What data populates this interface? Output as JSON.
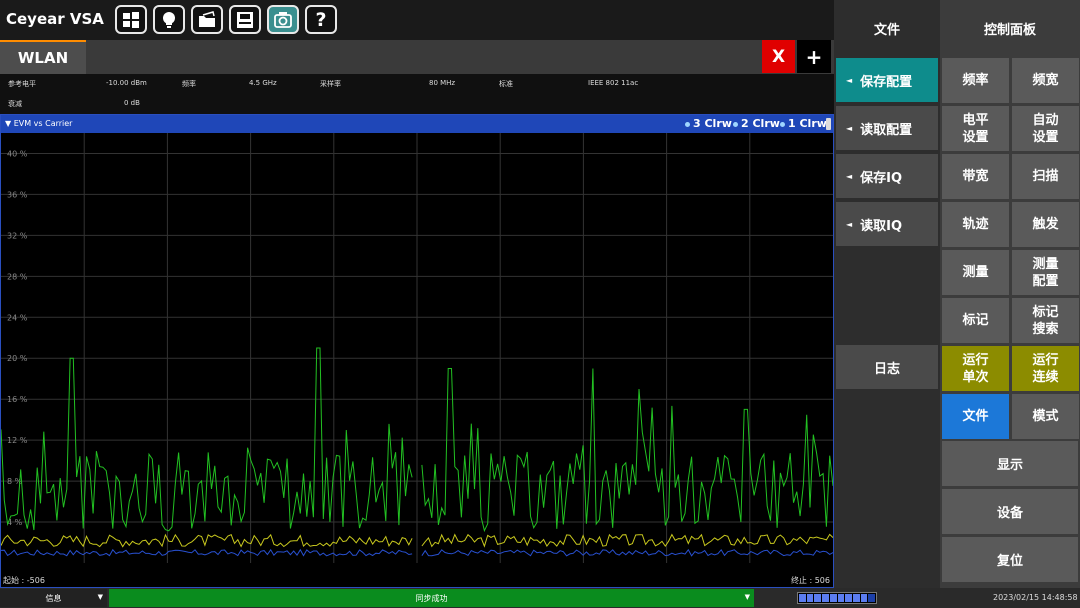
{
  "app": {
    "title": "Ceyear VSA",
    "toolbar_icons": [
      "windows-icon",
      "lightbulb-icon",
      "folder-open-icon",
      "save-disk-icon",
      "camera-icon",
      "help-icon"
    ],
    "help_glyph": "?"
  },
  "tabs": {
    "active": "WLAN",
    "close_label": "X",
    "add_label": "+"
  },
  "params": {
    "ref_level_label": "参考电平",
    "ref_level_value": "-10.00 dBm",
    "freq_label": "频率",
    "freq_value": "4.5 GHz",
    "sample_rate_label": "采样率",
    "sample_rate_value": "80 MHz",
    "standard_label": "标准",
    "standard_value": "IEEE 802 11ac",
    "atten_label": "衰减",
    "atten_value": "0 dB"
  },
  "plot": {
    "title": "▼ EVM vs Carrier",
    "traces": [
      "3 Clrw",
      "2 Clrw",
      "1 Clrw"
    ],
    "start_label": "起始 : -506",
    "stop_label": "终止 : 506"
  },
  "chart_data": {
    "type": "line",
    "title": "EVM vs Carrier",
    "x_range": [
      -506,
      506
    ],
    "ylim": [
      0,
      42
    ],
    "y_ticks": [
      "40 %",
      "36 %",
      "32 %",
      "28 %",
      "24 %",
      "20 %",
      "16 %",
      "12 %",
      "8 %",
      "4 %"
    ],
    "grid": true,
    "series": [
      {
        "color": "#22c022",
        "peaks_percent": [
          20,
          21,
          19,
          19,
          17,
          15
        ]
      },
      {
        "color": "#c8c81e"
      },
      {
        "color": "#2850d0"
      }
    ]
  },
  "file_menu": {
    "header": "文件",
    "items": [
      {
        "label": "保存配置",
        "selected": true
      },
      {
        "label": "读取配置",
        "selected": false
      },
      {
        "label": "保存IQ",
        "selected": false
      },
      {
        "label": "读取IQ",
        "selected": false
      }
    ],
    "log_label": "日志",
    "arrow": "◄"
  },
  "control_panel": {
    "header": "控制面板",
    "buttons": [
      {
        "line1": "频率",
        "line2": ""
      },
      {
        "line1": "频宽",
        "line2": ""
      },
      {
        "line1": "电平",
        "line2": "设置"
      },
      {
        "line1": "自动",
        "line2": "设置"
      },
      {
        "line1": "带宽",
        "line2": ""
      },
      {
        "line1": "扫描",
        "line2": ""
      },
      {
        "line1": "轨迹",
        "line2": ""
      },
      {
        "line1": "触发",
        "line2": ""
      },
      {
        "line1": "测量",
        "line2": ""
      },
      {
        "line1": "测量",
        "line2": "配置"
      },
      {
        "line1": "标记",
        "line2": ""
      },
      {
        "line1": "标记",
        "line2": "搜索"
      },
      {
        "line1": "运行",
        "line2": "单次"
      },
      {
        "line1": "运行",
        "line2": "连续"
      },
      {
        "line1": "文件",
        "line2": ""
      },
      {
        "line1": "模式",
        "line2": ""
      }
    ],
    "wide_buttons": [
      "显示",
      "设备",
      "复位"
    ]
  },
  "status": {
    "info_label": "信息",
    "sync_label": "同步成功",
    "dropdown_glyph": "▼",
    "progress_cells": 10,
    "progress_filled": 9,
    "datetime": "2023/02/15 14:48:58"
  }
}
